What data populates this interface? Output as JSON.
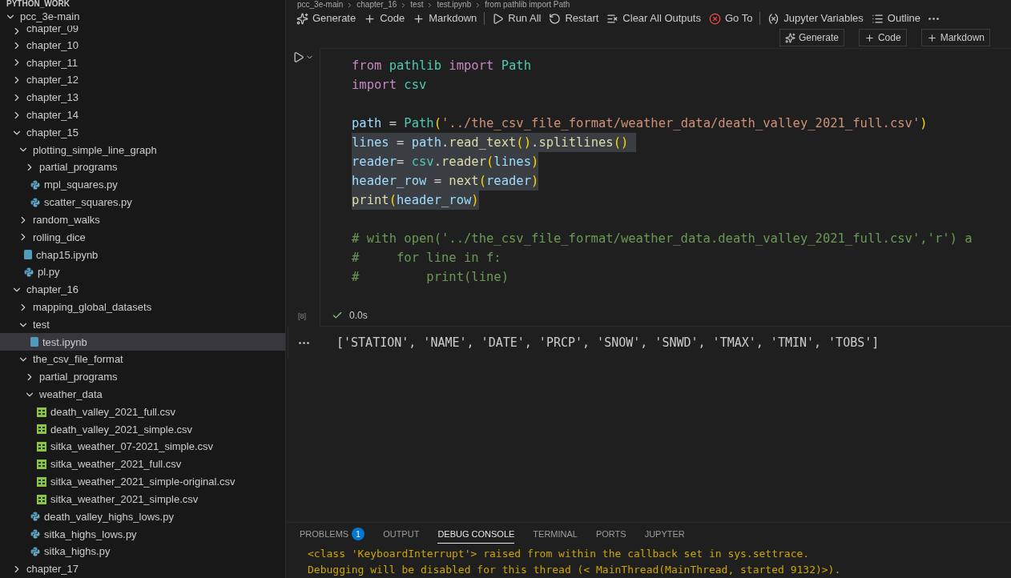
{
  "explorer": {
    "workspace": "PYTHON_WORK",
    "tree": [
      {
        "label": "pcc_3e-main",
        "kind": "folder",
        "expanded": true,
        "selected": false,
        "children": [
          {
            "label": "chapter_09",
            "kind": "folder",
            "expanded": false,
            "selected": false
          },
          {
            "label": "chapter_10",
            "kind": "folder",
            "expanded": false,
            "selected": false
          },
          {
            "label": "chapter_11",
            "kind": "folder",
            "expanded": false,
            "selected": false
          },
          {
            "label": "chapter_12",
            "kind": "folder",
            "expanded": false,
            "selected": false
          },
          {
            "label": "chapter_13",
            "kind": "folder",
            "expanded": false,
            "selected": false
          },
          {
            "label": "chapter_14",
            "kind": "folder",
            "expanded": false,
            "selected": false
          },
          {
            "label": "chapter_15",
            "kind": "folder",
            "expanded": true,
            "selected": false,
            "children": [
              {
                "label": "plotting_simple_line_graph",
                "kind": "folder",
                "expanded": true,
                "selected": false,
                "children": [
                  {
                    "label": "partial_programs",
                    "kind": "folder",
                    "expanded": false,
                    "selected": false
                  },
                  {
                    "label": "mpl_squares.py",
                    "kind": "python",
                    "selected": false
                  },
                  {
                    "label": "scatter_squares.py",
                    "kind": "python",
                    "selected": false
                  }
                ]
              },
              {
                "label": "random_walks",
                "kind": "folder",
                "expanded": false,
                "selected": false
              },
              {
                "label": "rolling_dice",
                "kind": "folder",
                "expanded": false,
                "selected": false
              },
              {
                "label": "chap15.ipynb",
                "kind": "notebook",
                "selected": false
              },
              {
                "label": "pl.py",
                "kind": "python",
                "selected": false
              }
            ]
          },
          {
            "label": "chapter_16",
            "kind": "folder",
            "expanded": true,
            "selected": false,
            "children": [
              {
                "label": "mapping_global_datasets",
                "kind": "folder",
                "expanded": false,
                "selected": false
              },
              {
                "label": "test",
                "kind": "folder",
                "expanded": true,
                "selected": false,
                "children": [
                  {
                    "label": "test.ipynb",
                    "kind": "notebook",
                    "selected": true
                  }
                ]
              },
              {
                "label": "the_csv_file_format",
                "kind": "folder",
                "expanded": true,
                "selected": false,
                "children": [
                  {
                    "label": "partial_programs",
                    "kind": "folder",
                    "expanded": false,
                    "selected": false
                  },
                  {
                    "label": "weather_data",
                    "kind": "folder",
                    "expanded": true,
                    "selected": false,
                    "children": [
                      {
                        "label": "death_valley_2021_full.csv",
                        "kind": "csv",
                        "selected": false
                      },
                      {
                        "label": "death_valley_2021_simple.csv",
                        "kind": "csv",
                        "selected": false
                      },
                      {
                        "label": "sitka_weather_07-2021_simple.csv",
                        "kind": "csv",
                        "selected": false
                      },
                      {
                        "label": "sitka_weather_2021_full.csv",
                        "kind": "csv",
                        "selected": false
                      },
                      {
                        "label": "sitka_weather_2021_simple-original.csv",
                        "kind": "csv",
                        "selected": false
                      },
                      {
                        "label": "sitka_weather_2021_simple.csv",
                        "kind": "csv",
                        "selected": false
                      }
                    ]
                  },
                  {
                    "label": "death_valley_highs_lows.py",
                    "kind": "python",
                    "selected": false
                  },
                  {
                    "label": "sitka_highs_lows.py",
                    "kind": "python",
                    "selected": false
                  },
                  {
                    "label": "sitka_highs.py",
                    "kind": "python",
                    "selected": false
                  }
                ]
              }
            ]
          },
          {
            "label": "chapter_17",
            "kind": "folder",
            "expanded": false,
            "selected": false
          }
        ]
      }
    ]
  },
  "breadcrumb": [
    "pcc_3e-main",
    "chapter_16",
    "test",
    "test.ipynb",
    "from pathlib import Path"
  ],
  "toolbar": [
    {
      "label": "Generate",
      "kind": "generate"
    },
    {
      "label": "Code",
      "kind": "add"
    },
    {
      "label": "Markdown",
      "kind": "add"
    },
    {
      "label": "Run All",
      "kind": "run",
      "divider": true
    },
    {
      "label": "Restart",
      "kind": "restart"
    },
    {
      "label": "Clear All Outputs",
      "kind": "clear"
    },
    {
      "label": "Go To",
      "kind": "goto"
    },
    {
      "label": "Jupyter Variables",
      "kind": "variables",
      "divider": true
    },
    {
      "label": "Outline",
      "kind": "outline"
    },
    {
      "kind": "more"
    }
  ],
  "cell_actions": [
    {
      "label": "Generate",
      "kind": "generate"
    },
    {
      "label": "Code",
      "kind": "add"
    },
    {
      "label": "Markdown",
      "kind": "add"
    }
  ],
  "cell": {
    "blocks": [
      [
        {
          "selected": false,
          "tokens": [
            {
              "t": "from",
              "kind": "kw"
            },
            {
              "t": " pathlib",
              "kind": "cls"
            },
            {
              "t": " import",
              "kind": "kw"
            },
            {
              "t": " Path",
              "kind": "cls"
            }
          ]
        },
        {
          "selected": false,
          "tokens": [
            {
              "t": "import",
              "kind": "kw"
            },
            {
              "t": " csv",
              "kind": "cls"
            }
          ]
        }
      ],
      [
        {
          "selected": false,
          "tokens": [
            {
              "t": "path",
              "kind": "var"
            },
            {
              "t": " =",
              "kind": "plain"
            },
            {
              "t": " Path",
              "kind": "cls"
            },
            {
              "t": "(",
              "kind": "paren"
            },
            {
              "t": "'../the_csv_file_format/weather_data/death_valley_2021_full.csv'",
              "kind": "str"
            },
            {
              "t": ")",
              "kind": "paren"
            }
          ]
        },
        {
          "selected": true,
          "tokens": [
            {
              "t": "lines",
              "kind": "var"
            },
            {
              "t": " =",
              "kind": "plain"
            },
            {
              "t": " path",
              "kind": "var"
            },
            {
              "t": ".",
              "kind": "plain"
            },
            {
              "t": "read_text",
              "kind": "fn"
            },
            {
              "t": "()",
              "kind": "paren"
            },
            {
              "t": ".",
              "kind": "plain"
            },
            {
              "t": "splitlines",
              "kind": "fn"
            },
            {
              "t": "() ",
              "kind": "paren"
            }
          ]
        },
        {
          "selected": true,
          "tokens": [
            {
              "t": "reader",
              "kind": "var"
            },
            {
              "t": "=",
              "kind": "plain"
            },
            {
              "t": " csv",
              "kind": "cls"
            },
            {
              "t": ".",
              "kind": "plain"
            },
            {
              "t": "reader",
              "kind": "fn"
            },
            {
              "t": "(",
              "kind": "paren"
            },
            {
              "t": "lines",
              "kind": "var"
            },
            {
              "t": ")",
              "kind": "paren"
            }
          ]
        },
        {
          "selected": true,
          "tokens": [
            {
              "t": "header_row",
              "kind": "var"
            },
            {
              "t": " =",
              "kind": "plain"
            },
            {
              "t": " next",
              "kind": "fn"
            },
            {
              "t": "(",
              "kind": "paren"
            },
            {
              "t": "reader",
              "kind": "var"
            },
            {
              "t": ")",
              "kind": "paren"
            }
          ]
        },
        {
          "selected": true,
          "tokens": [
            {
              "t": "print",
              "kind": "fn"
            },
            {
              "t": "(",
              "kind": "paren"
            },
            {
              "t": "header_row",
              "kind": "var"
            },
            {
              "t": ")",
              "kind": "paren"
            }
          ]
        }
      ],
      [
        {
          "selected": false,
          "tokens": [
            {
              "t": "# with open('../the_csv_file_format/weather_data.death_valley_2021_full.csv','r') a",
              "kind": "comment"
            }
          ]
        },
        {
          "selected": false,
          "tokens": [
            {
              "t": "#     for line in f:",
              "kind": "comment"
            }
          ]
        },
        {
          "selected": false,
          "tokens": [
            {
              "t": "#         print(line)",
              "kind": "comment"
            }
          ]
        }
      ]
    ],
    "execution_count": "[8]",
    "status": "0.0s",
    "output": "['STATION', 'NAME', 'DATE', 'PRCP', 'SNOW', 'SNWD', 'TMAX', 'TMIN', 'TOBS']"
  },
  "panel": {
    "tabs": [
      {
        "label": "PROBLEMS",
        "badge": "1",
        "selected": false
      },
      {
        "label": "OUTPUT",
        "selected": false
      },
      {
        "label": "DEBUG CONSOLE",
        "selected": true
      },
      {
        "label": "TERMINAL",
        "selected": false
      },
      {
        "label": "PORTS",
        "selected": false
      },
      {
        "label": "JUPYTER",
        "selected": false
      }
    ],
    "lines": [
      "<class 'KeyboardInterrupt'> raised from within the callback set in sys.settrace.",
      "Debugging will be disabled for this thread (< MainThread(MainThread, started 9132)>)."
    ]
  }
}
